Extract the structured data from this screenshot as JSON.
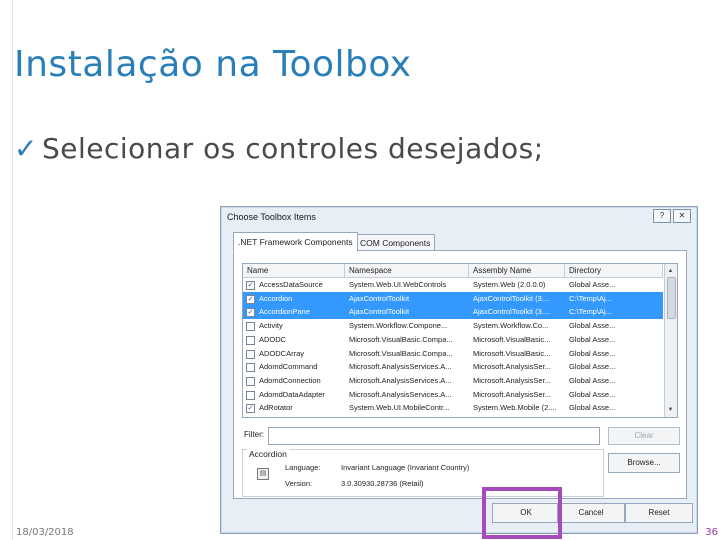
{
  "slide": {
    "title": "Instalação na Toolbox",
    "bullet_check": "✓",
    "bullet": "Selecionar os controles desejados;",
    "date": "18/03/2018",
    "page": "36",
    "accent_color": "#2a7fb8",
    "highlight_color": "#a64bbd"
  },
  "dialog": {
    "title": "Choose Toolbox Items",
    "help_glyph": "?",
    "close_glyph": "✕",
    "tabs": [
      ".NET Framework Components",
      "COM Components"
    ],
    "columns": [
      "Name",
      "Namespace",
      "Assembly Name",
      "Directory"
    ],
    "rows": [
      {
        "checked": true,
        "selected": false,
        "name": "AccessDataSource",
        "namespace": "System.Web.UI.WebControls",
        "assembly": "System.Web (2.0.0.0)",
        "directory": "Global Asse..."
      },
      {
        "checked": true,
        "selected": true,
        "name": "Accordion",
        "namespace": "AjaxControlToolkit",
        "assembly": "AjaxControlToolkit (3....",
        "directory": "C:\\Temp\\Aj..."
      },
      {
        "checked": true,
        "selected": true,
        "name": "AccordionPane",
        "namespace": "AjaxControlToolkit",
        "assembly": "AjaxControlToolkit (3....",
        "directory": "C:\\Temp\\Aj..."
      },
      {
        "checked": false,
        "selected": false,
        "name": "Activity",
        "namespace": "System.Workflow.Compone...",
        "assembly": "System.Workflow.Co...",
        "directory": "Global Asse..."
      },
      {
        "checked": false,
        "selected": false,
        "name": "ADODC",
        "namespace": "Microsoft.VisualBasic.Compa...",
        "assembly": "Microsoft.VisualBasic...",
        "directory": "Global Asse..."
      },
      {
        "checked": false,
        "selected": false,
        "name": "ADODCArray",
        "namespace": "Microsoft.VisualBasic.Compa...",
        "assembly": "Microsoft.VisualBasic...",
        "directory": "Global Asse..."
      },
      {
        "checked": false,
        "selected": false,
        "name": "AdomdCommand",
        "namespace": "Microsoft.AnalysisServices.A...",
        "assembly": "Microsoft.AnalysisSer...",
        "directory": "Global Asse..."
      },
      {
        "checked": false,
        "selected": false,
        "name": "AdomdConnection",
        "namespace": "Microsoft.AnalysisServices.A...",
        "assembly": "Microsoft.AnalysisSer...",
        "directory": "Global Asse..."
      },
      {
        "checked": false,
        "selected": false,
        "name": "AdomdDataAdapter",
        "namespace": "Microsoft.AnalysisServices.A...",
        "assembly": "Microsoft.AnalysisSer...",
        "directory": "Global Asse..."
      },
      {
        "checked": true,
        "selected": false,
        "name": "AdRotator",
        "namespace": "System.Web.UI.MobileContr...",
        "assembly": "System.Web.Mobile (2....",
        "directory": "Global Asse..."
      }
    ],
    "filter_label": "Filter:",
    "filter_value": "",
    "clear_label": "Clear",
    "browse_label": "Browse...",
    "info": {
      "name": "Accordion",
      "language_label": "Language:",
      "language_value": "Invariant Language (Invariant Country)",
      "version_label": "Version:",
      "version_value": "3.0.30930.28736 (Retail)"
    },
    "ok_label": "OK",
    "cancel_label": "Cancel",
    "reset_label": "Reset"
  }
}
